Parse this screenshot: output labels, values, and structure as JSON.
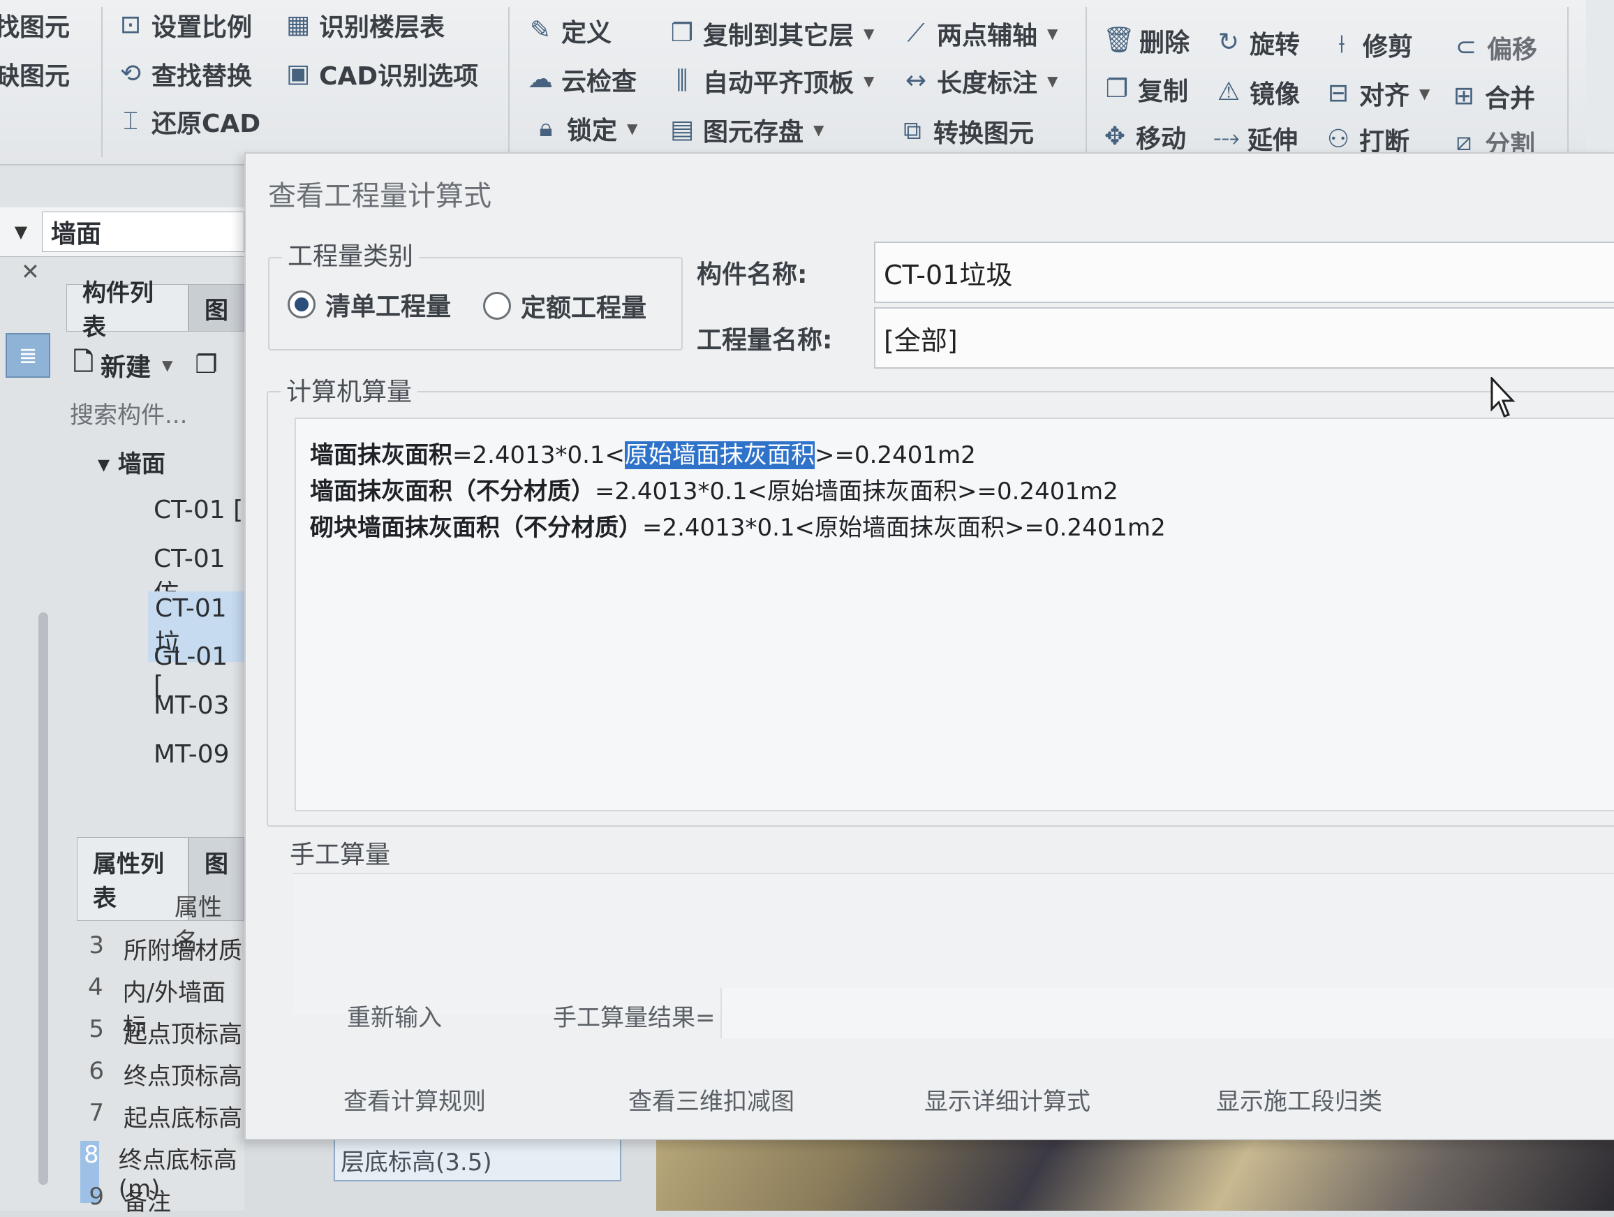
{
  "ribbon": {
    "group1": {
      "item1": "找图元",
      "item2": "缺图元"
    },
    "group2": {
      "set_scale": "设置比例",
      "identify_floor_table": "识别楼层表",
      "find_replace": "查找替换",
      "cad_options": "CAD识别选项",
      "restore_cad": "还原CAD"
    },
    "group3": {
      "define": "定义",
      "copy_to_layer": "复制到其它层",
      "two_point_axis": "两点辅轴",
      "cloud_check": "云检查",
      "auto_align_slab": "自动平齐顶板",
      "length_dim": "长度标注",
      "lock": "锁定",
      "element_save": "图元存盘",
      "convert_element": "转换图元"
    },
    "group4": {
      "delete": "删除",
      "rotate": "旋转",
      "trim": "修剪",
      "offset": "偏移",
      "copy": "复制",
      "mirror": "镜像",
      "align": "对齐",
      "merge": "合并",
      "move": "移动",
      "extend": "延伸",
      "break": "打断",
      "split": "分割"
    }
  },
  "left": {
    "combo_value": "墙面",
    "tab_component_list": "构件列表",
    "tab_other": "图",
    "new_label": "新建",
    "search_placeholder": "搜索构件...",
    "tree_header": "墙面",
    "tree_items": [
      "CT-01 [",
      "CT-01仿",
      "CT-01垃",
      "GL-01 [",
      "MT-03",
      "MT-09"
    ],
    "prop_tab": "属性列表",
    "prop_tab_other": "图",
    "prop_header": "属性名",
    "props": [
      {
        "n": "3",
        "name": "所附墙材质"
      },
      {
        "n": "4",
        "name": "内/外墙面标"
      },
      {
        "n": "5",
        "name": "起点顶标高"
      },
      {
        "n": "6",
        "name": "终点顶标高"
      },
      {
        "n": "7",
        "name": "起点底标高"
      },
      {
        "n": "8",
        "name": "终点底标高(m)"
      },
      {
        "n": "9",
        "name": "备注"
      }
    ],
    "prop8_value": "层底标高(3.5)"
  },
  "dialog": {
    "title": "查看工程量计算式",
    "qty_type_legend": "工程量类别",
    "radio_bill": "清单工程量",
    "radio_quota": "定额工程量",
    "component_name_label": "构件名称:",
    "component_name_value": "CT-01垃圾",
    "qty_name_label": "工程量名称:",
    "qty_name_value": "[全部]",
    "computer_calc_legend": "计算机算量",
    "formulas": [
      {
        "name": "墙面抹灰面积",
        "expr_a": "=2.4013*0.1<",
        "expr_b": "原始墙面抹灰面积",
        "expr_c": ">=0.2401m2"
      },
      {
        "name": "墙面抹灰面积（不分材质）",
        "expr_a": "=2.4013*0.1<",
        "expr_b": "原始墙面抹灰面积",
        "expr_c": ">=0.2401m2"
      },
      {
        "name": "砌块墙面抹灰面积（不分材质）",
        "expr_a": "=2.4013*0.1<",
        "expr_b": "原始墙面抹灰面积",
        "expr_c": ">=0.2401m2"
      }
    ],
    "manual_calc_legend": "手工算量",
    "reenter": "重新输入",
    "manual_result": "手工算量结果=",
    "view_rules": "查看计算规则",
    "view_3d": "查看三维扣减图",
    "show_detail": "显示详细计算式",
    "show_stage": "显示施工段归类"
  },
  "colors": {
    "selection": "#2f72c9",
    "dialog_bg": "#eef0f1"
  }
}
